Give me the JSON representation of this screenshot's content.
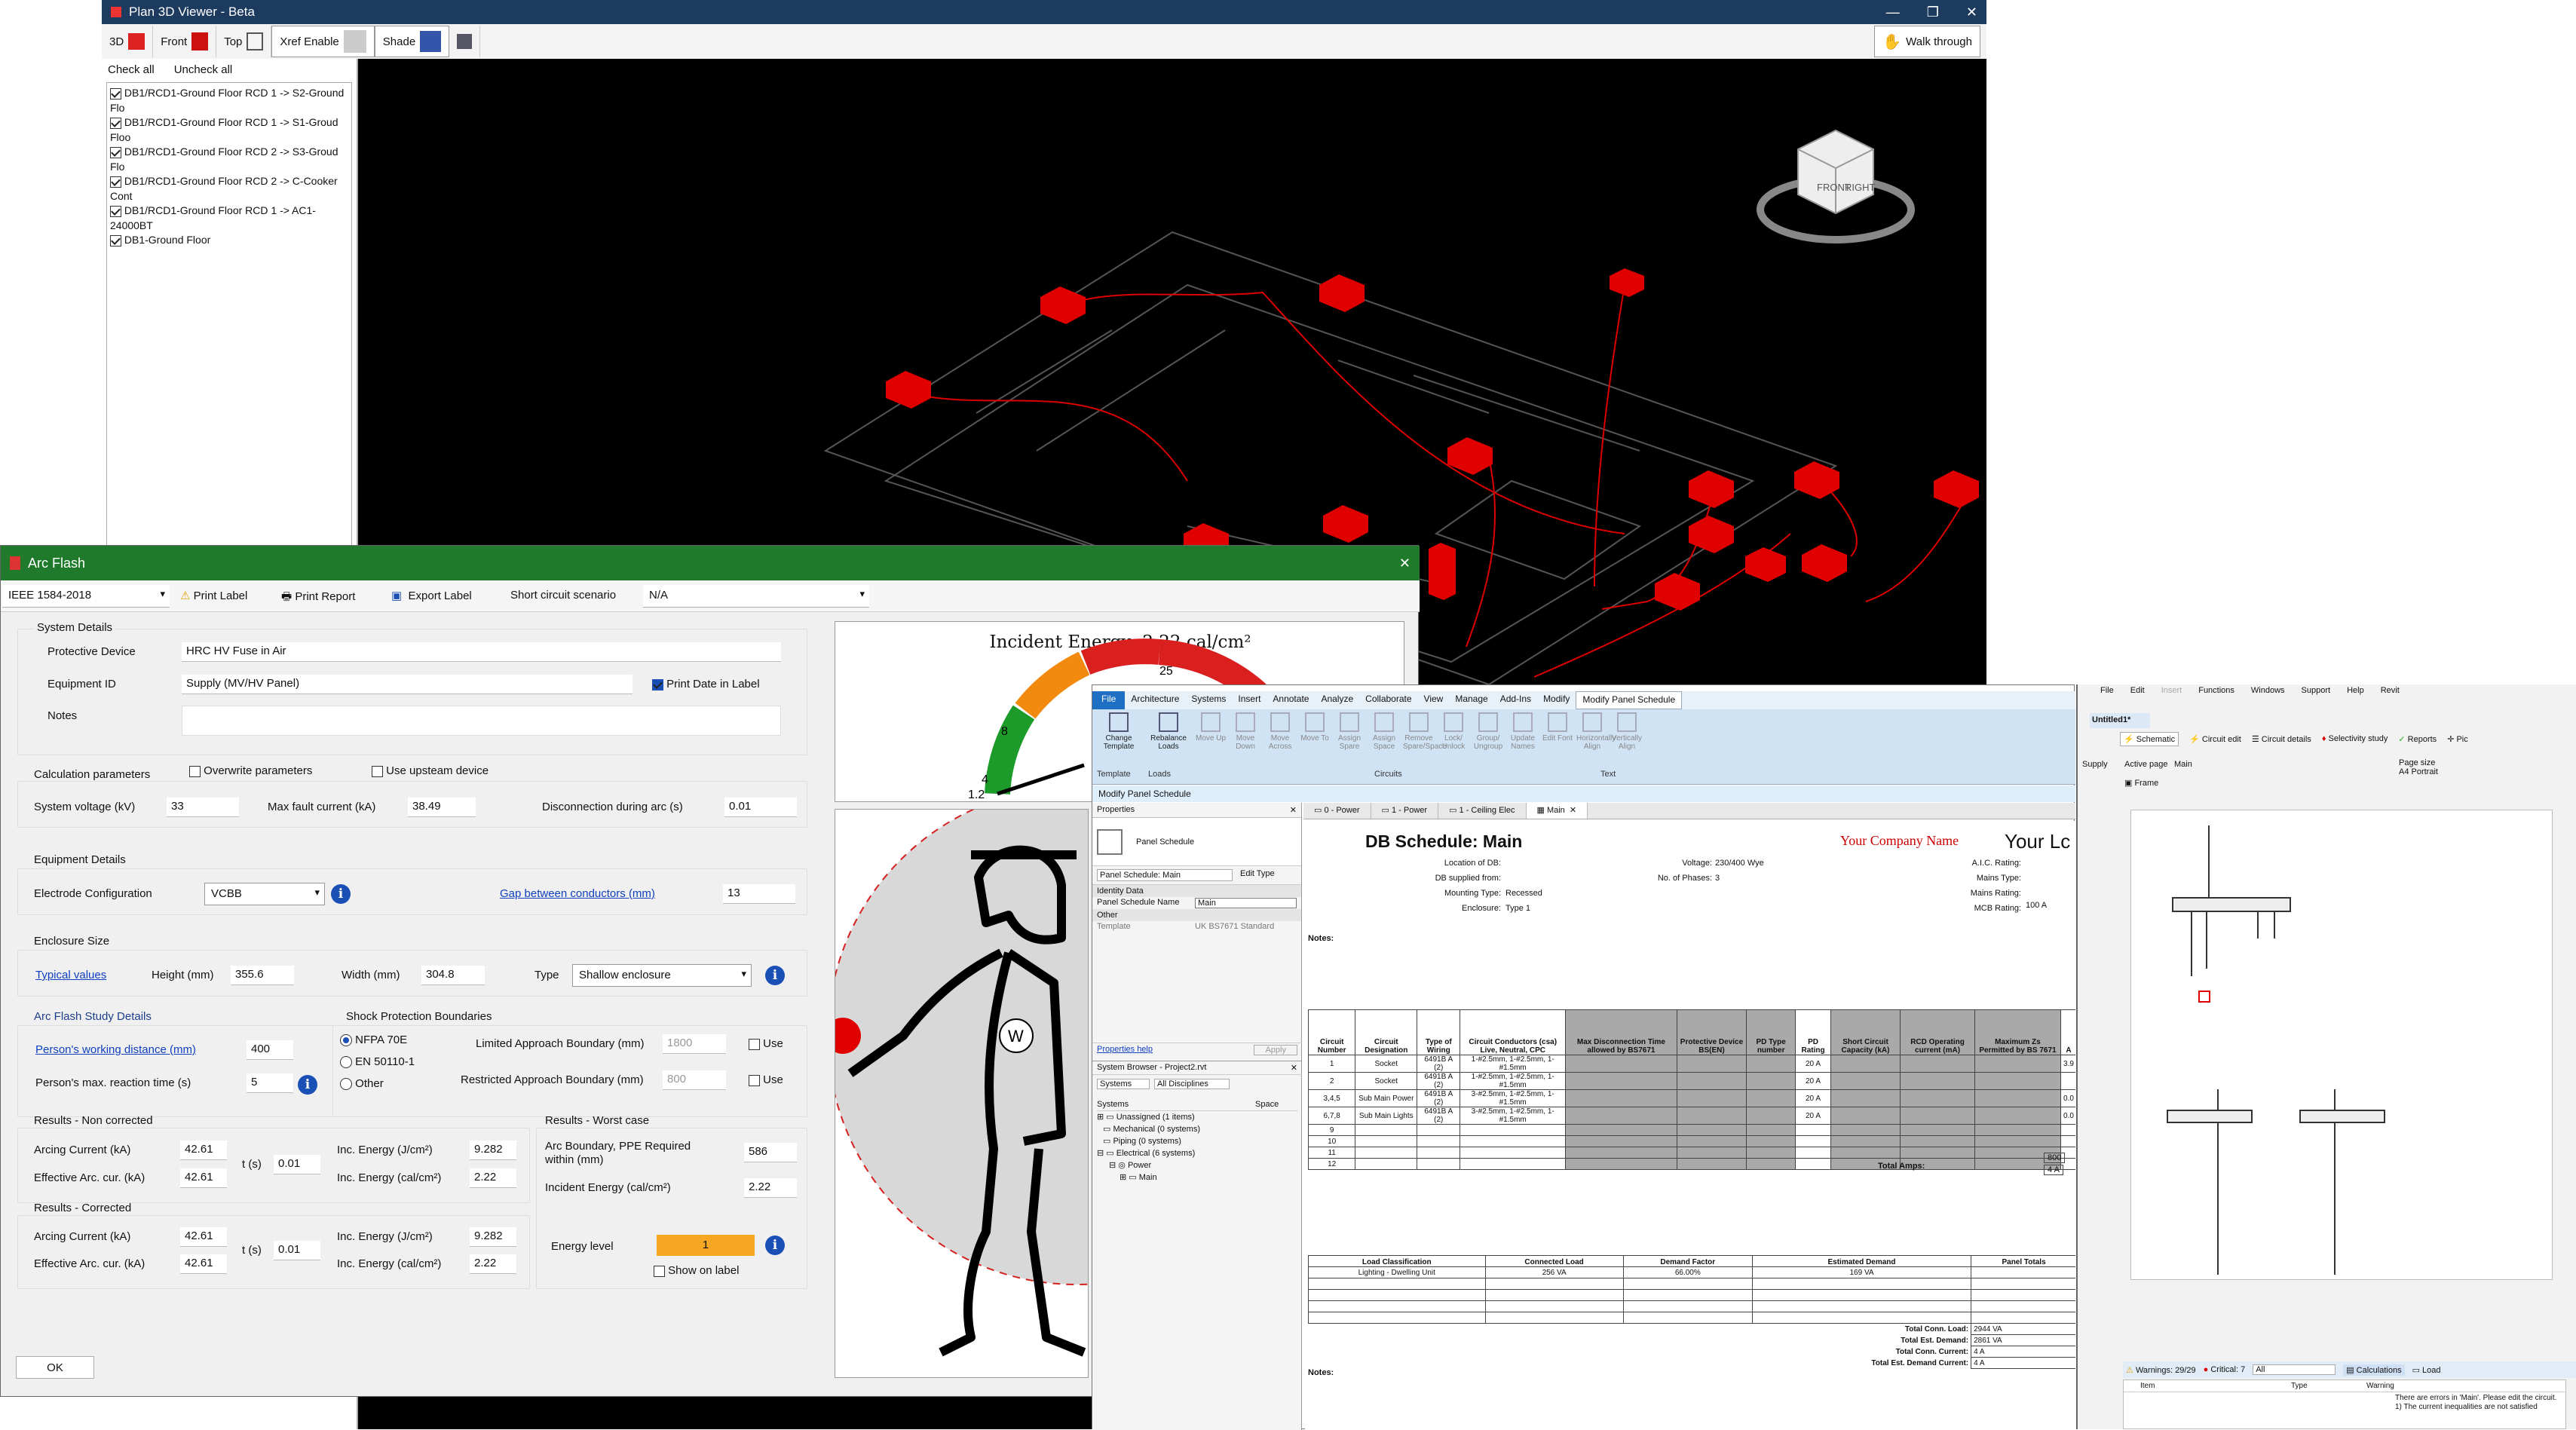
{
  "viewer": {
    "title": "Plan 3D Viewer - Beta",
    "toolbar": {
      "btn_3d": "3D",
      "front": "Front",
      "top": "Top",
      "xref": "Xref Enable",
      "shade": "Shade",
      "walk": "Walk through"
    },
    "check_all": "Check all",
    "uncheck_all": "Uncheck all",
    "layers": [
      "DB1/RCD1-Ground Floor RCD 1 -> S2-Ground Flo",
      "DB1/RCD1-Ground Floor RCD 1 -> S1-Groud Floo",
      "DB1/RCD1-Ground Floor RCD 2 -> S3-Groud Flo",
      "DB1/RCD1-Ground Floor RCD 2 -> C-Cooker Cont",
      "DB1/RCD1-Ground Floor RCD 1 -> AC1-24000BT",
      "DB1-Ground Floor"
    ],
    "cube": {
      "front": "FRONT",
      "right": "RIGHT"
    }
  },
  "arc": {
    "title": "Arc Flash",
    "standard": "IEEE 1584-2018",
    "print_label": "Print Label",
    "print_report": "Print Report",
    "export_label": "Export Label",
    "scenario_label": "Short circuit scenario",
    "scenario_value": "N/A",
    "system_details": "System Details",
    "protective_device_label": "Protective Device",
    "protective_device": "HRC HV Fuse in Air",
    "equipment_id_label": "Equipment ID",
    "equipment_id": "Supply (MV/HV Panel)",
    "print_date": "Print Date in Label",
    "notes_label": "Notes",
    "calc_params": "Calculation parameters",
    "overwrite": "Overwrite parameters",
    "upstream": "Use upsteam device",
    "sys_voltage_label": "System voltage (kV)",
    "sys_voltage": "33",
    "max_fault_label": "Max fault current (kA)",
    "max_fault": "38.49",
    "disconnection_label": "Disconnection during arc (s)",
    "disconnection": "0.01",
    "equipment_details": "Equipment Details",
    "electrode_label": "Electrode Configuration",
    "electrode": "VCBB",
    "gap_label": "Gap between conductors (mm)",
    "gap": "13",
    "enclosure_size": "Enclosure Size",
    "typical_values": "Typical values",
    "height_label": "Height (mm)",
    "height": "355.6",
    "width_label": "Width (mm)",
    "width": "304.8",
    "type_label": "Type",
    "type": "Shallow enclosure",
    "study_details": "Arc Flash Study Details",
    "working_distance_label": "Person's working distance (mm)",
    "working_distance": "400",
    "reaction_label": "Person's max. reaction time (s)",
    "reaction": "5",
    "shock": "Shock Protection Boundaries",
    "nfpa": "NFPA 70E",
    "en": "EN 50110-1",
    "other": "Other",
    "limited_label": "Limited Approach Boundary (mm)",
    "limited": "1800",
    "restricted_label": "Restricted Approach Boundary (mm)",
    "restricted": "800",
    "use": "Use",
    "non_corrected": "Results - Non corrected",
    "corrected": "Results - Corrected",
    "worst": "Results - Worst case",
    "arcing_label": "Arcing Current (kA)",
    "effective_label": "Effective Arc. cur. (kA)",
    "t_label": "t (s)",
    "inc_j_label": "Inc. Energy (J/cm²)",
    "inc_cal_label": "Inc. Energy (cal/cm²)",
    "nc": {
      "arcing": "42.61",
      "effective": "42.61",
      "t": "0.01",
      "inc_j": "9.282",
      "inc_cal": "2.22"
    },
    "c": {
      "arcing": "42.61",
      "effective": "42.61",
      "t": "0.01",
      "inc_j": "9.282",
      "inc_cal": "2.22"
    },
    "boundary_label": "Arc Boundary, PPE Required within (mm)",
    "boundary": "586",
    "incident_label": "Incident Energy (cal/cm²)",
    "incident": "2.22",
    "energy_level_label": "Energy level",
    "energy_level": "1",
    "show_on_label": "Show on label",
    "ok": "OK",
    "gauge": {
      "title": "Incident Energy: 2.22 cal/cm²",
      "t25": "25",
      "t8": "8",
      "t4": "4",
      "t12": "1.2"
    },
    "w": "W"
  },
  "revit": {
    "tabs": [
      "File",
      "Architecture",
      "Systems",
      "Insert",
      "Annotate",
      "Analyze",
      "Collaborate",
      "View",
      "Manage",
      "Add-Ins",
      "Modify",
      "Modify Panel Schedule"
    ],
    "ribbon": [
      "Change Template",
      "Rebalance Loads",
      "Move Up",
      "Move Down",
      "Move Across",
      "Move To",
      "Assign Spare",
      "Assign Space",
      "Remove Spare/Space",
      "Lock/ Unlock",
      "Group/ Ungroup",
      "Update Names",
      "Edit Font",
      "Horizontally Align",
      "Vertically Align"
    ],
    "ribbon_groups": [
      "Template",
      "Loads",
      "Circuits",
      "Text"
    ],
    "context": "Modify Panel Schedule",
    "properties": "Properties",
    "panel_schedule": "Panel Schedule",
    "ps_main": "Panel Schedule: Main",
    "edit_type": "Edit Type",
    "identity": "Identity Data",
    "psn_label": "Panel Schedule Name",
    "psn": "Main",
    "other": "Other",
    "template_label": "Template",
    "template": "UK BS7671 Standard",
    "help": "Properties help",
    "apply": "Apply",
    "browser_title": "System Browser - Project2.rvt",
    "sys_dd": "Systems",
    "disc_dd": "All Disciplines",
    "tree_col1": "Systems",
    "tree_col2": "Space",
    "tree": [
      "Unassigned (1 items)",
      "Mechanical (0 systems)",
      "Piping (0 systems)",
      "Electrical (6 systems)",
      "Power",
      "Main"
    ],
    "view_tabs": [
      "0 - Power",
      "1 - Power",
      "1 - Ceiling Elec",
      "Main"
    ],
    "sched": {
      "title": "DB Schedule: Main",
      "company": "Your Company Name",
      "your_lc": "Your Lc",
      "loc": "Location of DB:",
      "supplied": "DB supplied from:",
      "mounting": "Mounting Type:",
      "mounting_v": "Recessed",
      "enclosure": "Enclosure:",
      "enclosure_v": "Type 1",
      "voltage": "Voltage:",
      "voltage_v": "230/400 Wye",
      "phases": "No. of Phases:",
      "phases_v": "3",
      "aic": "A.I.C. Rating:",
      "mains_type": "Mains Type:",
      "mains_rating": "Mains Rating:",
      "mains_rating_v": "100 A",
      "mcb": "MCB Rating:",
      "notes": "Notes:",
      "headers": [
        "Circuit Number",
        "Circuit Designation",
        "Type of Wiring",
        "Circuit Conductors (csa) Live, Neutral, CPC",
        "Max Disconnection Time allowed by BS7671",
        "Protective Device BS(EN)",
        "PD Type number",
        "PD Rating",
        "Short Circuit Capacity (kA)",
        "RCD Operating current (mA)",
        "Maximum Zs Permitted by BS 7671",
        "A"
      ],
      "rows": [
        [
          "1",
          "Socket",
          "6491B A (2)",
          "1-#2.5mm, 1-#2.5mm, 1-#1.5mm",
          "",
          "",
          "",
          "20 A",
          "",
          "",
          "",
          "3.9"
        ],
        [
          "2",
          "Socket",
          "6491B A (2)",
          "1-#2.5mm, 1-#2.5mm, 1-#1.5mm",
          "",
          "",
          "",
          "20 A",
          "",
          "",
          "",
          ""
        ],
        [
          "3,4,5",
          "Sub Main Power",
          "6491B A (2)",
          "3-#2.5mm, 1-#2.5mm, 1-#1.5mm",
          "",
          "",
          "",
          "20 A",
          "",
          "",
          "",
          "0.0"
        ],
        [
          "6,7,8",
          "Sub Main Lights",
          "6491B A (2)",
          "3-#2.5mm, 1-#2.5mm, 1-#1.5mm",
          "",
          "",
          "",
          "20 A",
          "",
          "",
          "",
          "0.0"
        ],
        [
          "9",
          "",
          "",
          "",
          "",
          "",
          "",
          "",
          "",
          "",
          "",
          ""
        ],
        [
          "10",
          "",
          "",
          "",
          "",
          "",
          "",
          "",
          "",
          "",
          "",
          ""
        ],
        [
          "11",
          "",
          "",
          "",
          "",
          "",
          "",
          "",
          "",
          "",
          "",
          ""
        ],
        [
          "12",
          "",
          "",
          "",
          "",
          "",
          "",
          "",
          "",
          "",
          "",
          ""
        ]
      ],
      "total_amps": "Total Amps:",
      "ta1": "800",
      "ta2": "4 A",
      "load_headers": [
        "Load Classification",
        "Connected Load",
        "Demand Factor",
        "Estimated Demand",
        "Panel Totals"
      ],
      "load_row": [
        "Lighting - Dwelling Unit",
        "256 VA",
        "66.00%",
        "169 VA"
      ],
      "totals": [
        [
          "Total Conn. Load:",
          "2944 VA"
        ],
        [
          "Total Est. Demand:",
          "2861 VA"
        ],
        [
          "Total Conn. Current:",
          "4 A"
        ],
        [
          "Total Est. Demand Current:",
          "4 A"
        ]
      ],
      "notes2": "Notes:"
    }
  },
  "schem": {
    "menu": [
      "File",
      "Edit",
      "Insert",
      "Functions",
      "Windows",
      "Support",
      "Help",
      "Revit"
    ],
    "doc_tab": "Untitled1*",
    "toolbar": [
      "Schematic",
      "Circuit edit",
      "Circuit details",
      "Selectivity study",
      "Reports",
      "Pic"
    ],
    "supply": "Supply",
    "active_page": "Active page",
    "page": "Main",
    "page_size": "Page size",
    "page_size_v": "A4 Portrait",
    "frame": "Frame",
    "warnings": "Warnings: 29/29",
    "critical": "Critical: 7",
    "all": "All",
    "calculations": "Calculations",
    "load": "Load",
    "cols": [
      "Item",
      "Type",
      "Warning"
    ],
    "warning_text": "There are errors in 'Main'. Please edit the circuit. 1) The current inequalities are not satisfied"
  },
  "colors": {
    "title_bar": "#1d3a5f",
    "arc_green": "#1f7a2b",
    "revit_blue": "#cfe3f5",
    "marker": "#e00000",
    "energy": "#f5a623"
  }
}
